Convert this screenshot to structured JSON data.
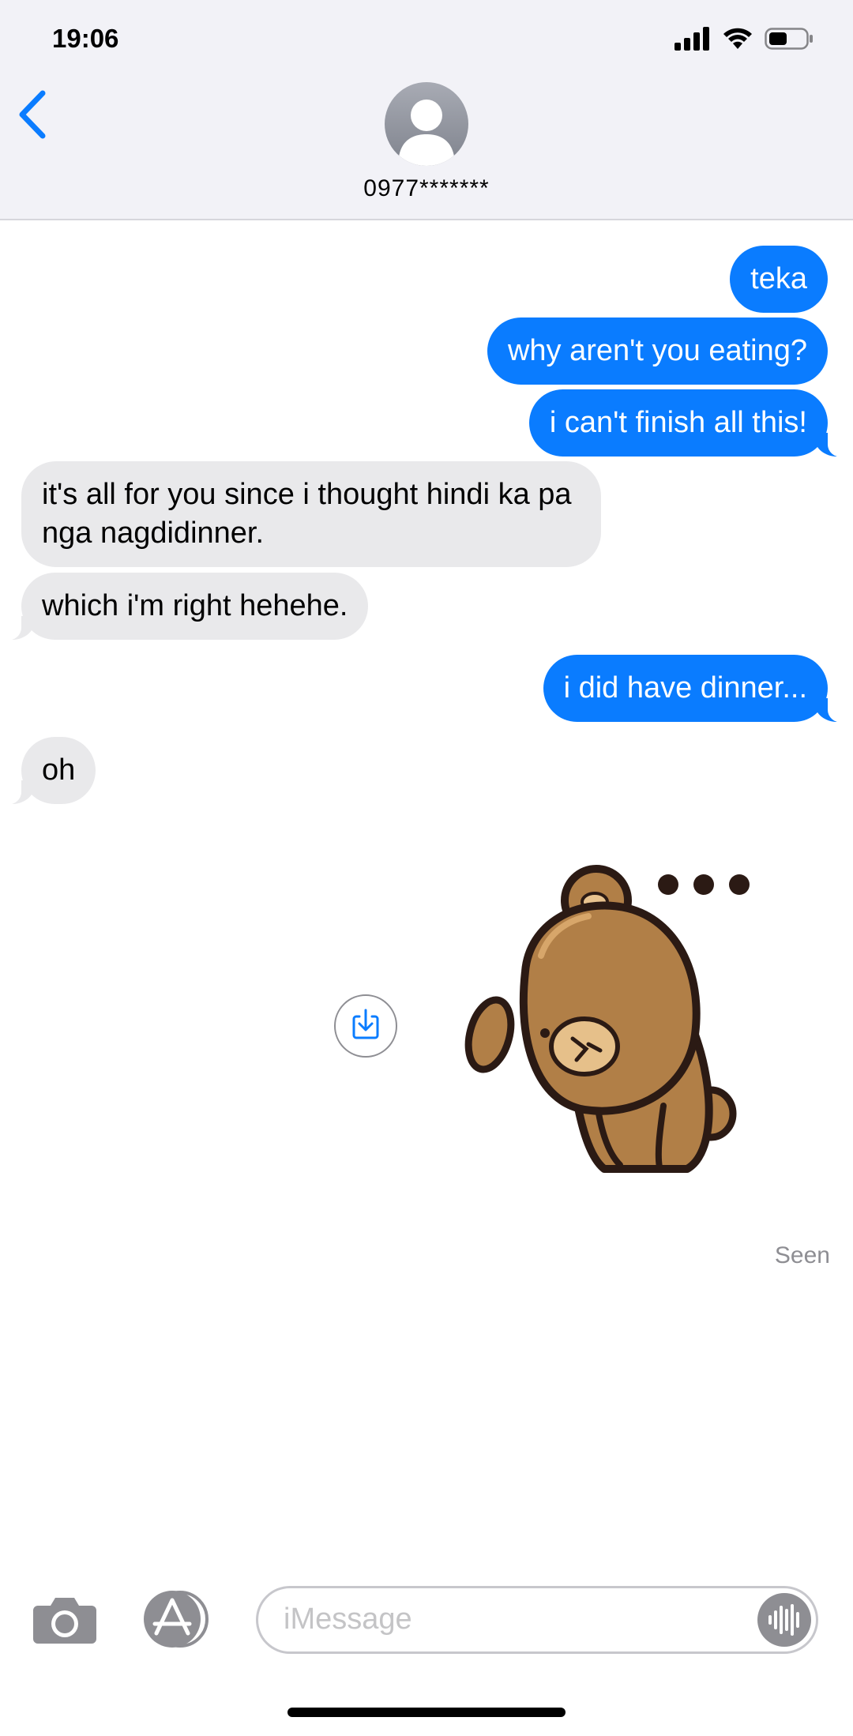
{
  "status_bar": {
    "time": "19:06",
    "icons": [
      "cellular-signal-icon",
      "wifi-icon",
      "battery-icon"
    ]
  },
  "header": {
    "contact_name": "0977*******",
    "back_icon": "chevron-left-icon",
    "avatar_icon": "person-silhouette-icon"
  },
  "messages": [
    {
      "direction": "outgoing",
      "text": "teka"
    },
    {
      "direction": "outgoing",
      "text": "why aren't you eating?"
    },
    {
      "direction": "outgoing",
      "text": "i can't finish all this!"
    },
    {
      "direction": "incoming",
      "text": "it's all for you since i thought hindi ka pa nga nagdidinner."
    },
    {
      "direction": "incoming",
      "text": "which i'm right hehehe."
    },
    {
      "direction": "outgoing",
      "text": "i did have dinner..."
    },
    {
      "direction": "incoming",
      "text": "oh"
    },
    {
      "direction": "incoming",
      "type": "sticker",
      "sticker": "brown-bear-ellipsis-sticker"
    }
  ],
  "read_receipt": "Seen",
  "composer": {
    "placeholder": "iMessage",
    "camera_icon": "camera-icon",
    "apps_icon": "app-store-icon",
    "audio_icon": "audio-waveform-icon"
  },
  "colors": {
    "outgoing_bubble": "#0a7cff",
    "incoming_bubble": "#e9e9eb",
    "accent": "#0a7cff"
  }
}
